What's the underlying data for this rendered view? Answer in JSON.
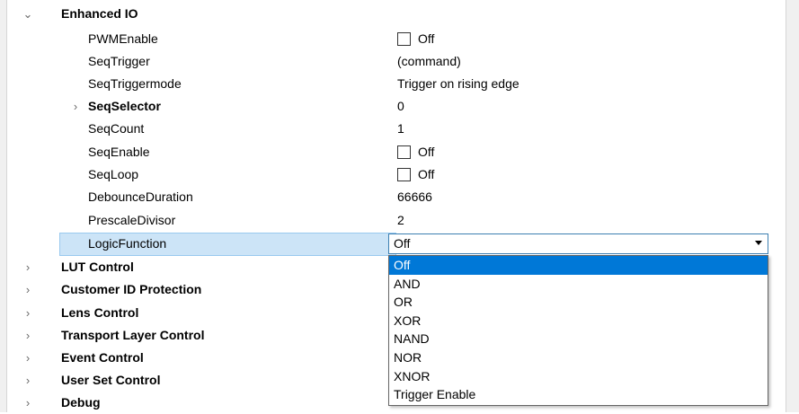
{
  "tree": {
    "group": {
      "name": "Enhanced IO",
      "expanded": true
    },
    "properties": [
      {
        "name": "PWMEnable",
        "value": "Off",
        "checkbox": true
      },
      {
        "name": "SeqTrigger",
        "value": "(command)"
      },
      {
        "name": "SeqTriggermode",
        "value": "Trigger on rising edge"
      },
      {
        "name": "SeqSelector",
        "value": "0",
        "bold": true,
        "expandable": true
      },
      {
        "name": "SeqCount",
        "value": "1"
      },
      {
        "name": "SeqEnable",
        "value": "Off",
        "checkbox": true
      },
      {
        "name": "SeqLoop",
        "value": "Off",
        "checkbox": true
      },
      {
        "name": "DebounceDuration",
        "value": "66666"
      },
      {
        "name": "PrescaleDivisor",
        "value": "2"
      },
      {
        "name": "LogicFunction",
        "value": "Off",
        "selected": true
      }
    ],
    "collapsed_groups": [
      "LUT Control",
      "Customer ID Protection",
      "Lens Control",
      "Transport Layer Control",
      "Event Control",
      "User Set Control",
      "Debug"
    ]
  },
  "dropdown": {
    "selected": "Off",
    "options": [
      "Off",
      "AND",
      "OR",
      "XOR",
      "NAND",
      "NOR",
      "XNOR",
      "Trigger Enable"
    ]
  },
  "colors": {
    "selection_bg": "#cce4f7",
    "highlight": "#0078d7",
    "combo_border": "#3c7fb1"
  },
  "icons": {
    "expanded": "chevron-down-icon",
    "collapsed": "chevron-right-icon",
    "combo": "caret-down-icon"
  }
}
